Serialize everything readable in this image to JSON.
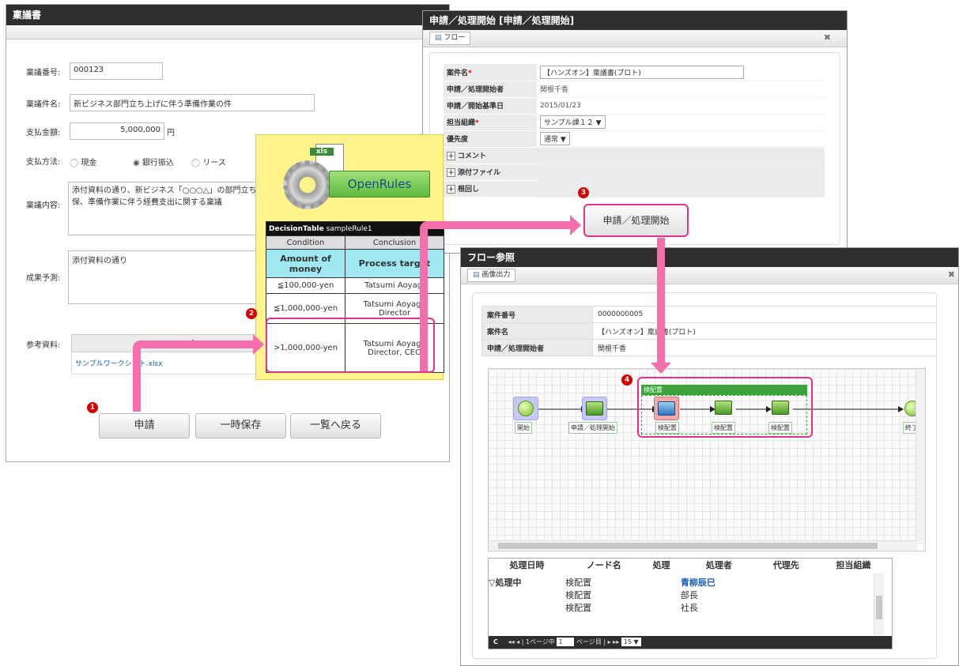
{
  "ringi": {
    "title": "稟議書",
    "number_label": "稟議番号:",
    "number_value": "000123",
    "subject_label": "稟議件名:",
    "subject_value": "新ビジネス部門立ち上げに伴う準備作業の件",
    "amount_label": "支払金額:",
    "amount_value": "5,000,000",
    "amount_unit": "円",
    "method_label": "支払方法:",
    "method_options": [
      "現金",
      "銀行振込",
      "リース"
    ],
    "method_selected": "銀行振込",
    "content_label": "稟議内容:",
    "content_value": "添付資料の通り、新ビジネス「○○○△」の部門立ち上げに\n保、準備作業に伴う経費支出に関する稟議",
    "forecast_label": "成果予測:",
    "forecast_value": "添付資料の通り",
    "ref_label": "参考資料:",
    "ref_header": "ファイル名",
    "ref_file": "サンプルワークシート.xlsx",
    "buttons": {
      "apply": "申請",
      "save": "一時保存",
      "back": "一覧へ戻る"
    }
  },
  "openrules": {
    "file_label": "xls",
    "brand": "OpenRules",
    "table_title_bold": "DecisionTable",
    "table_title": "sampleRule1",
    "col_condition": "Condition",
    "col_conclusion": "Conclusion",
    "head_amount": "Amount of money",
    "head_target": "Process target",
    "rows": [
      {
        "cond": "≦100,000-yen",
        "target": "Tatsumi Aoyagi"
      },
      {
        "cond": "≦1,000,000-yen",
        "target": "Tatsumi Aoyagi, Director"
      },
      {
        "cond": ">1,000,000-yen",
        "target": "Tatsumi Aoyagi, Director, CEO"
      }
    ]
  },
  "start_dialog": {
    "title": "申請／処理開始 [申請／処理開始]",
    "flow_btn": "フロー",
    "close": "✖",
    "fields": [
      {
        "label": "案件名",
        "required": true,
        "value": "【ハンズオン】稟議書(プロト)",
        "type": "input"
      },
      {
        "label": "申請／処理開始者",
        "required": false,
        "value": "関根千香",
        "type": "text"
      },
      {
        "label": "申請／開始基準日",
        "required": false,
        "value": "2015/01/23",
        "type": "text"
      },
      {
        "label": "担当組織",
        "required": true,
        "value": "サンプル課１２ ▼",
        "type": "select"
      },
      {
        "label": "優先度",
        "required": false,
        "value": "通常 ▼",
        "type": "select"
      },
      {
        "label": "コメント",
        "required": false,
        "value": "",
        "type": "expand"
      },
      {
        "label": "添付ファイル",
        "required": false,
        "value": "",
        "type": "expand"
      },
      {
        "label": "根回し",
        "required": false,
        "value": "",
        "type": "expand"
      }
    ],
    "required_mark": "*",
    "start_button": "申請／処理開始"
  },
  "flow_dialog": {
    "title": "フロー参照",
    "export_btn": "画像出力",
    "close": "✖",
    "info": [
      {
        "label": "案件番号",
        "value": "0000000005"
      },
      {
        "label": "案件名",
        "value": "【ハンズオン】稟議書(プロト)"
      },
      {
        "label": "申請／処理開始者",
        "value": "関根千香"
      }
    ],
    "nodes": [
      "開始",
      "申請／処理開始",
      "検配置",
      "検配置",
      "検配置",
      "終了"
    ],
    "group_label": "検配置",
    "history_headers": [
      "処理日時",
      "ノード名",
      "処理",
      "処理者",
      "代理先",
      "担当組織"
    ],
    "history_rows": [
      {
        "date": "▽処理中",
        "node": "検配置",
        "action": "",
        "person": "青柳辰巳",
        "proxy": "",
        "org": ""
      },
      {
        "date": "",
        "node": "検配置",
        "action": "",
        "person": "部長",
        "proxy": "",
        "org": ""
      },
      {
        "date": "",
        "node": "検配置",
        "action": "",
        "person": "社長",
        "proxy": "",
        "org": ""
      }
    ],
    "pager": {
      "refresh": "C",
      "first_prev": "◂◂ ◂",
      "page_prefix": "1ページ中",
      "page_value": "1",
      "page_suffix": "ページ目",
      "next_last": "▸ ▸▸",
      "size": "15 ▼"
    }
  },
  "steps": [
    "1",
    "2",
    "3",
    "4"
  ],
  "colors": {
    "accent": "#e0338c",
    "arrow": "#f46fab",
    "titlebar": "#2e2e2e",
    "grid_head": "#2a4d80"
  }
}
